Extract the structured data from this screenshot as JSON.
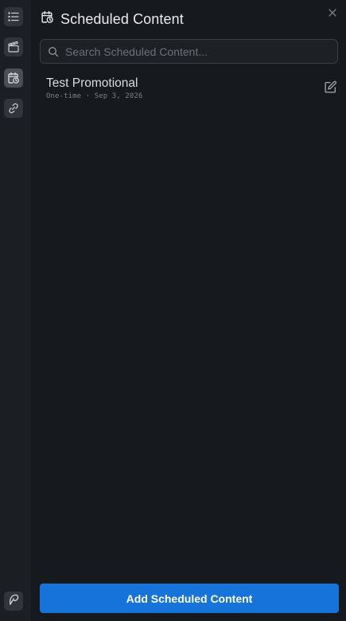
{
  "rail": {
    "items": [
      {
        "icon": "list-icon",
        "active": false
      },
      {
        "icon": "clapperboard-icon",
        "active": false
      },
      {
        "icon": "calendar-clock-icon",
        "active": true
      },
      {
        "icon": "link-icon",
        "active": false
      }
    ],
    "logo_icon": "app-logo-icon"
  },
  "header": {
    "icon": "calendar-clock-icon",
    "title": "Scheduled Content",
    "close_icon": "close-icon"
  },
  "search": {
    "placeholder": "Search Scheduled Content...",
    "value": ""
  },
  "items": [
    {
      "title": "Test Promotional",
      "meta": "One-time · Sep 3, 2026",
      "edit_icon": "edit-icon"
    }
  ],
  "footer": {
    "add_label": "Add Scheduled Content"
  },
  "colors": {
    "background": "#16191d",
    "rail": "#1b1e22",
    "accent": "#1673d9"
  }
}
